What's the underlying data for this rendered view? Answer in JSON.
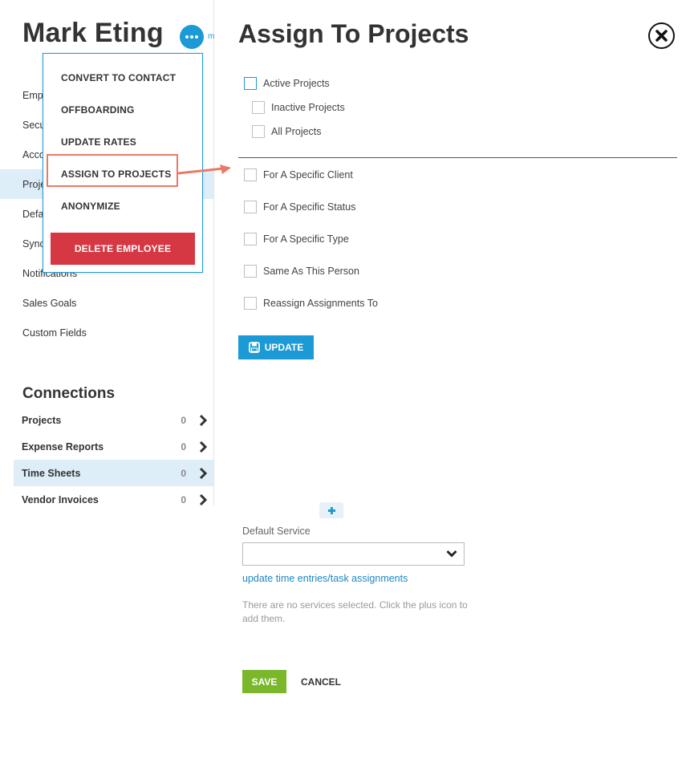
{
  "employee": {
    "name": "Mark Eting",
    "more_cut_label": "m"
  },
  "left_nav": {
    "items": [
      {
        "label": "Emp"
      },
      {
        "label": "Secu"
      },
      {
        "label": "Acco"
      },
      {
        "label": "Proje",
        "active": true
      },
      {
        "label": "Defa"
      },
      {
        "label": "Sync"
      },
      {
        "label": "Notifications"
      },
      {
        "label": "Sales Goals"
      },
      {
        "label": "Custom Fields"
      }
    ]
  },
  "connections": {
    "title": "Connections",
    "rows": [
      {
        "label": "Projects",
        "count": "0"
      },
      {
        "label": "Expense Reports",
        "count": "0"
      },
      {
        "label": "Time Sheets",
        "count": "0",
        "active": true
      },
      {
        "label": "Vendor Invoices",
        "count": "0"
      }
    ]
  },
  "menu": {
    "items": [
      "CONVERT TO CONTACT",
      "OFFBOARDING",
      "UPDATE RATES",
      "ASSIGN TO PROJECTS",
      "ANONYMIZE"
    ],
    "delete_label": "DELETE EMPLOYEE",
    "highlight_color": "#ea7a68"
  },
  "assign": {
    "title": "Assign To Projects",
    "project_scope": [
      "Active Projects",
      "Inactive Projects",
      "All Projects"
    ],
    "filters": [
      "For A Specific Client",
      "For A Specific Status",
      "For A Specific Type",
      "Same As This Person",
      "Reassign Assignments To"
    ],
    "update_label": "UPDATE"
  },
  "services": {
    "default_service_label": "Default Service",
    "default_service_value": "",
    "update_link": "update time entries/task assignments",
    "empty_text": "There are no services selected. Click the plus icon to add them."
  },
  "footer": {
    "save_label": "SAVE",
    "cancel_label": "CANCEL"
  },
  "colors": {
    "accent": "#1b9ad6",
    "danger": "#d63843",
    "save": "#7bb72b",
    "active_row": "#ddeef9"
  }
}
